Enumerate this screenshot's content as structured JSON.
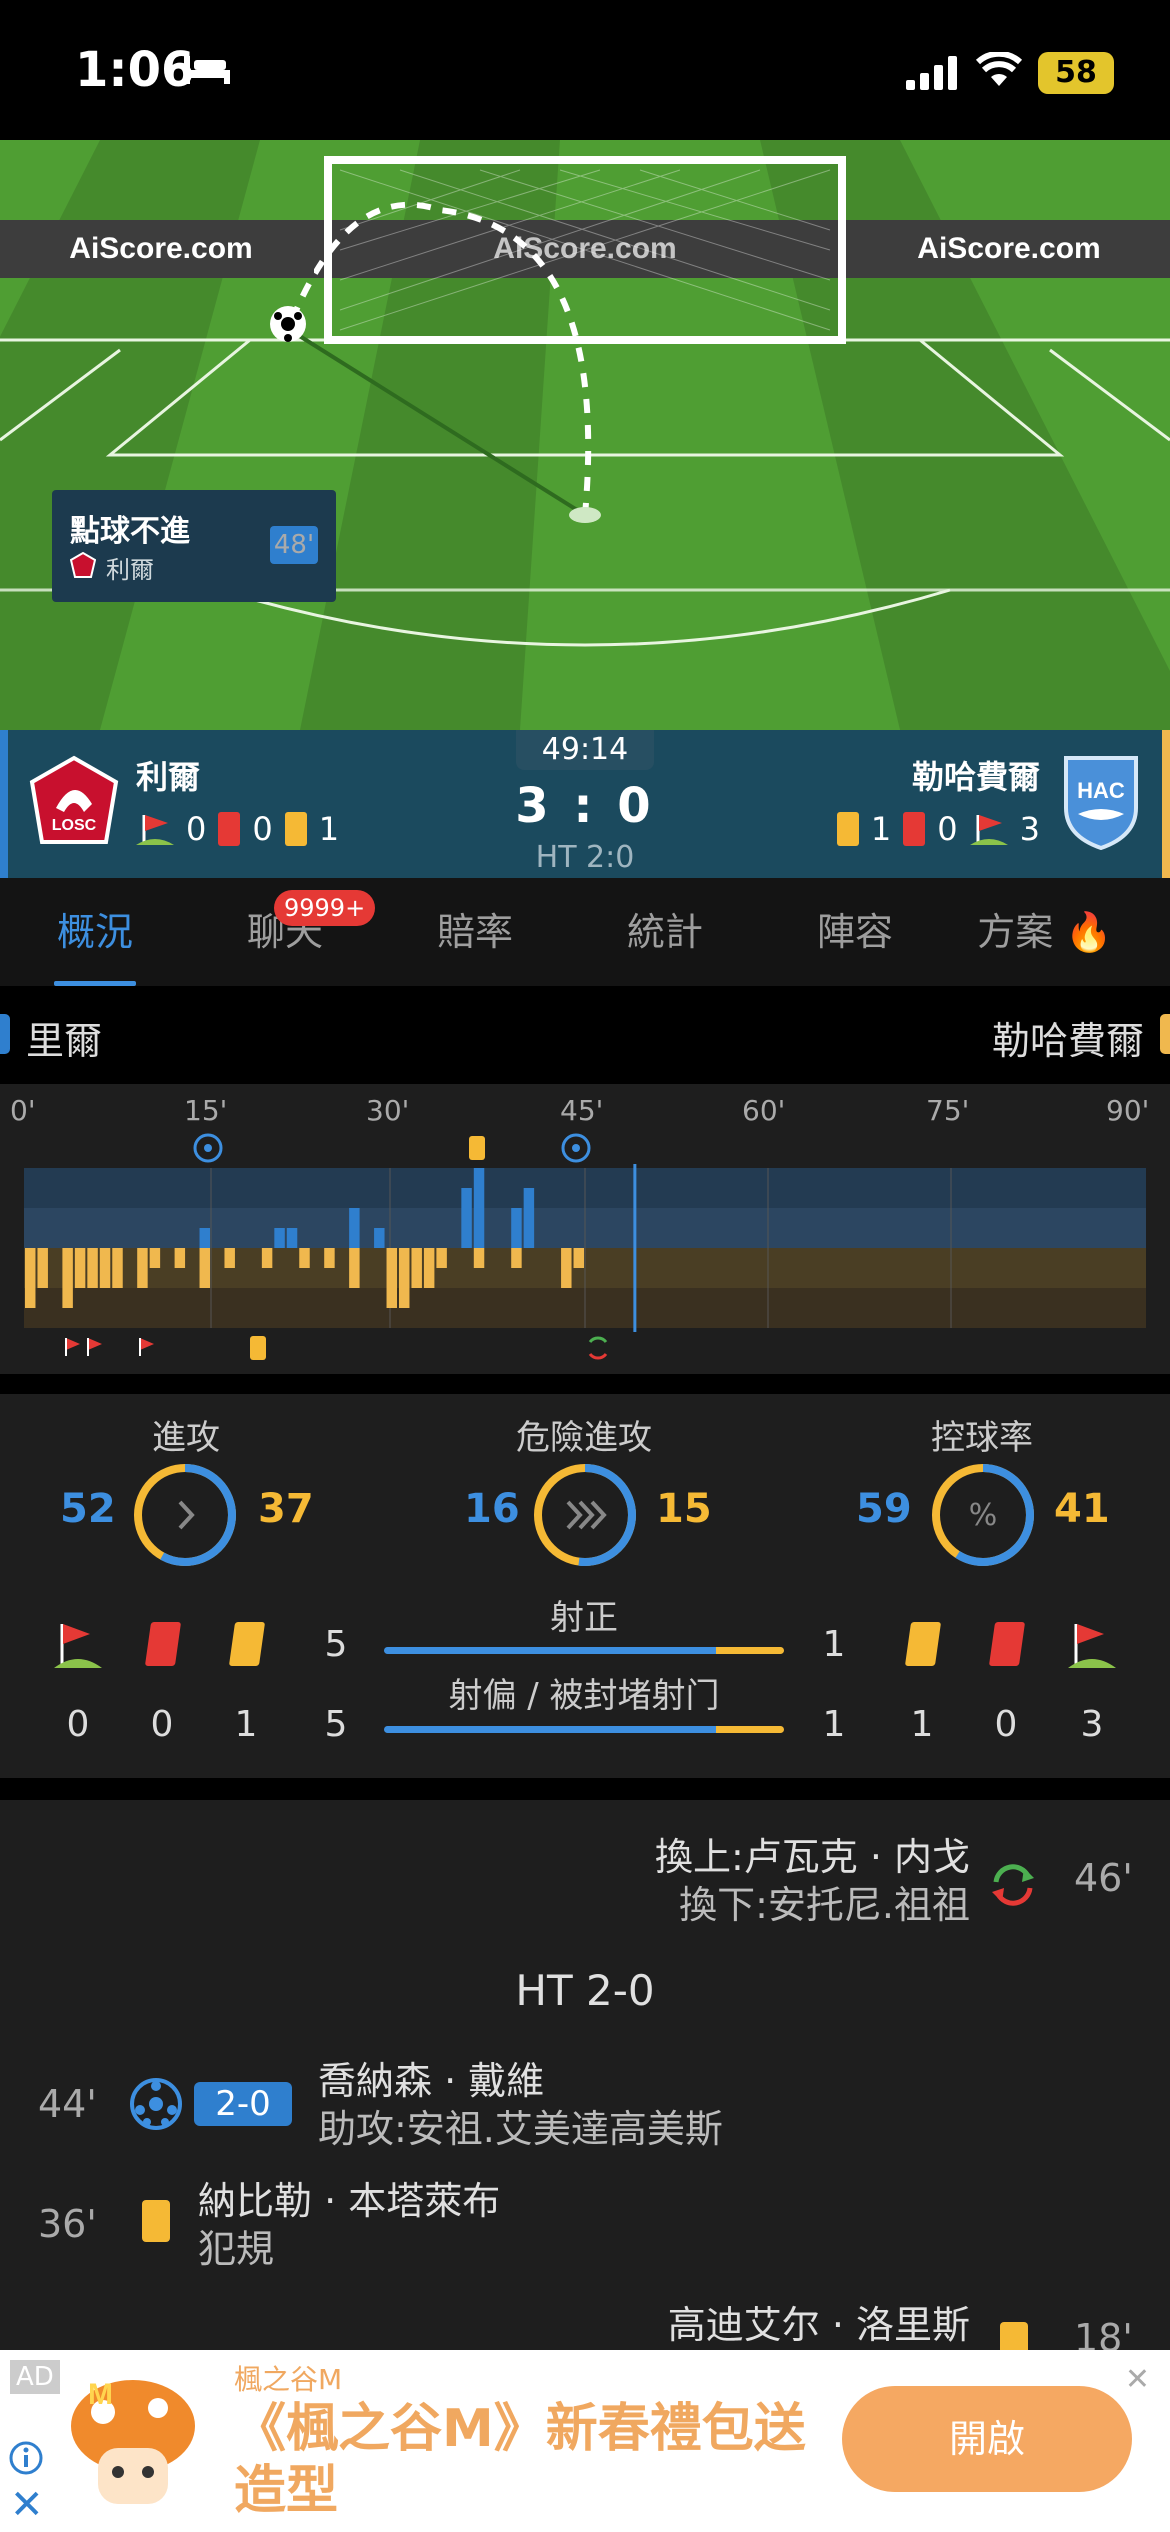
{
  "status": {
    "time": "1:06",
    "battery": "58"
  },
  "pitch": {
    "boards": [
      "AiScore.com",
      "AiScore.com",
      "AiScore.com"
    ],
    "event_title": "點球不進",
    "event_team": "利爾",
    "event_minute": "48'"
  },
  "match": {
    "home": "利爾",
    "away": "勒哈費爾",
    "clock": "49:14",
    "score": "3 : 0",
    "ht": "HT 2:0",
    "home_stats": {
      "corners": "0",
      "red": "0",
      "yellow": "1"
    },
    "away_stats": {
      "yellow": "1",
      "red": "0",
      "corners": "3"
    },
    "home_badge": "LOSC",
    "away_badge": "HAC"
  },
  "tabs": [
    "概況",
    "聊天",
    "賠率",
    "統計",
    "陣容",
    "方案"
  ],
  "chat_badge": "9999+",
  "teams_row": {
    "home": "里爾",
    "away": "勒哈費爾"
  },
  "timeline": {
    "ticks": [
      "0'",
      "15'",
      "30'",
      "45'",
      "60'",
      "75'",
      "90'"
    ],
    "current_minute": 49,
    "home_pressure": [
      0,
      0,
      0,
      0,
      0,
      0,
      0,
      0,
      0,
      0,
      0,
      0,
      0,
      0,
      1,
      0,
      0,
      0,
      0,
      0,
      1,
      1,
      0,
      0,
      0,
      0,
      2,
      0,
      1,
      0,
      0,
      0,
      0,
      0,
      0,
      3,
      4,
      0,
      0,
      2,
      3,
      0,
      0,
      0,
      0
    ],
    "away_pressure": [
      3,
      2,
      0,
      3,
      2,
      2,
      2,
      2,
      0,
      2,
      1,
      0,
      1,
      0,
      2,
      0,
      1,
      0,
      0,
      1,
      0,
      0,
      1,
      0,
      1,
      0,
      2,
      0,
      0,
      3,
      3,
      2,
      2,
      1,
      0,
      0,
      1,
      0,
      0,
      1,
      0,
      0,
      0,
      2,
      1
    ]
  },
  "stats": {
    "attack": {
      "label": "進攻",
      "home": "52",
      "away": "37",
      "home_frac": 0.58
    },
    "danger": {
      "label": "危險進攻",
      "home": "16",
      "away": "15",
      "home_frac": 0.52
    },
    "possession": {
      "label": "控球率",
      "home": "59",
      "away": "41",
      "home_frac": 0.59
    },
    "on_target": {
      "label": "射正",
      "home": "5",
      "away": "1",
      "home_frac": 0.83
    },
    "off_target": {
      "label": "射偏 / 被封堵射门",
      "home": "5",
      "away": "1",
      "home_frac": 0.83
    },
    "home_counts": {
      "corners": "0",
      "red": "0",
      "yellow": "1"
    },
    "away_counts": {
      "yellow": "1",
      "red": "0",
      "corners": "3"
    }
  },
  "events": {
    "sub": {
      "minute": "46'",
      "in": "換上:卢瓦克 · 内戈",
      "out": "換下:安托尼.祖祖"
    },
    "ht_label": "HT 2-0",
    "goal": {
      "minute": "44'",
      "score": "2-0",
      "player": "喬納森 · 戴維",
      "assist": "助攻:安祖.艾美達高美斯"
    },
    "card1": {
      "minute": "36'",
      "player": "納比勒 · 本塔萊布",
      "reason": "犯規"
    },
    "card2": {
      "minute": "18'",
      "player": "高迪艾尔 · 洛里斯"
    }
  },
  "ad": {
    "tag": "AD",
    "brand": "楓之谷M",
    "message": "《楓之谷M》新春禮包送造型",
    "button": "開啟"
  },
  "colors": {
    "home": "#2f7fce",
    "away": "#f0b84e",
    "pitch": "#4f9e33",
    "score_bar": "#1b4a5e"
  }
}
